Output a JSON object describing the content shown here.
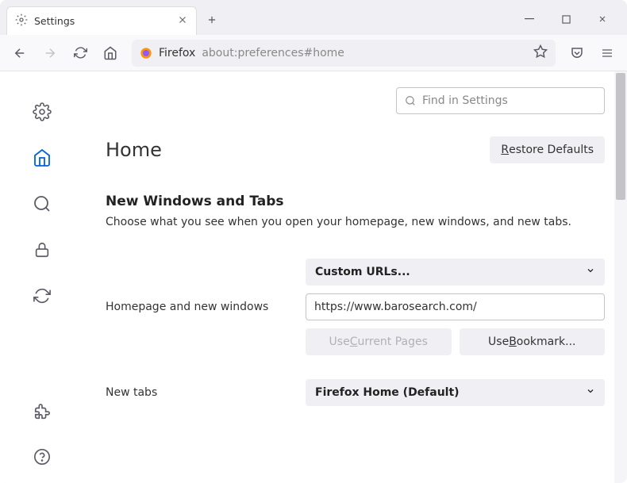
{
  "tab": {
    "title": "Settings"
  },
  "urlbar": {
    "label": "Firefox",
    "url": "about:preferences#home"
  },
  "search": {
    "placeholder": "Find in Settings"
  },
  "heading": "Home",
  "restore_defaults": "Restore Defaults",
  "section": {
    "title": "New Windows and Tabs",
    "description": "Choose what you see when you open your homepage, new windows, and new tabs."
  },
  "homepage": {
    "label": "Homepage and new windows",
    "dropdown": "Custom URLs...",
    "url": "https://www.barosearch.com/",
    "use_current": "Use Current Pages",
    "use_bookmark": "Use Bookmark..."
  },
  "newtabs": {
    "label": "New tabs",
    "dropdown": "Firefox Home (Default)"
  }
}
